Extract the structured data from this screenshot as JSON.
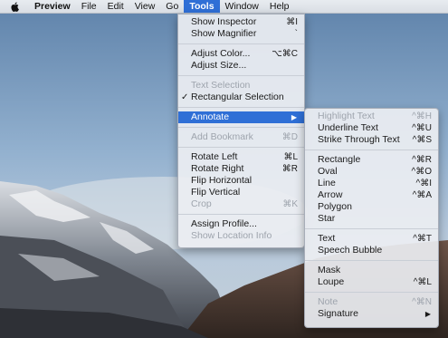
{
  "menubar": {
    "items": [
      "Preview",
      "File",
      "Edit",
      "View",
      "Go",
      "Tools",
      "Window",
      "Help"
    ]
  },
  "tools_menu": {
    "items": [
      {
        "label": "Show Inspector",
        "shortcut": "⌘I"
      },
      {
        "label": "Show Magnifier",
        "shortcut": "`"
      },
      {
        "label": "Adjust Color...",
        "shortcut": "⌥⌘C"
      },
      {
        "label": "Adjust Size..."
      },
      {
        "label": "Text Selection"
      },
      {
        "label": "Rectangular Selection"
      },
      {
        "label": "Annotate"
      },
      {
        "label": "Add Bookmark",
        "shortcut": "⌘D"
      },
      {
        "label": "Rotate Left",
        "shortcut": "⌘L"
      },
      {
        "label": "Rotate Right",
        "shortcut": "⌘R"
      },
      {
        "label": "Flip Horizontal"
      },
      {
        "label": "Flip Vertical"
      },
      {
        "label": "Crop",
        "shortcut": "⌘K"
      },
      {
        "label": "Assign Profile..."
      },
      {
        "label": "Show Location Info"
      }
    ]
  },
  "annotate_menu": {
    "items": [
      {
        "label": "Highlight Text",
        "shortcut": "^⌘H"
      },
      {
        "label": "Underline Text",
        "shortcut": "^⌘U"
      },
      {
        "label": "Strike Through Text",
        "shortcut": "^⌘S"
      },
      {
        "label": "Rectangle",
        "shortcut": "^⌘R"
      },
      {
        "label": "Oval",
        "shortcut": "^⌘O"
      },
      {
        "label": "Line",
        "shortcut": "^⌘I"
      },
      {
        "label": "Arrow",
        "shortcut": "^⌘A"
      },
      {
        "label": "Polygon"
      },
      {
        "label": "Star"
      },
      {
        "label": "Text",
        "shortcut": "^⌘T"
      },
      {
        "label": "Speech Bubble"
      },
      {
        "label": "Mask"
      },
      {
        "label": "Loupe",
        "shortcut": "^⌘L"
      },
      {
        "label": "Note",
        "shortcut": "^⌘N"
      },
      {
        "label": "Signature"
      }
    ]
  },
  "colors": {
    "menu_highlight": "#2f6fd6",
    "disabled_text": "#9ea4ad"
  },
  "icons": {
    "apple": "apple-logo-icon",
    "check": "checkmark-icon",
    "submenu": "submenu-arrow-icon"
  }
}
